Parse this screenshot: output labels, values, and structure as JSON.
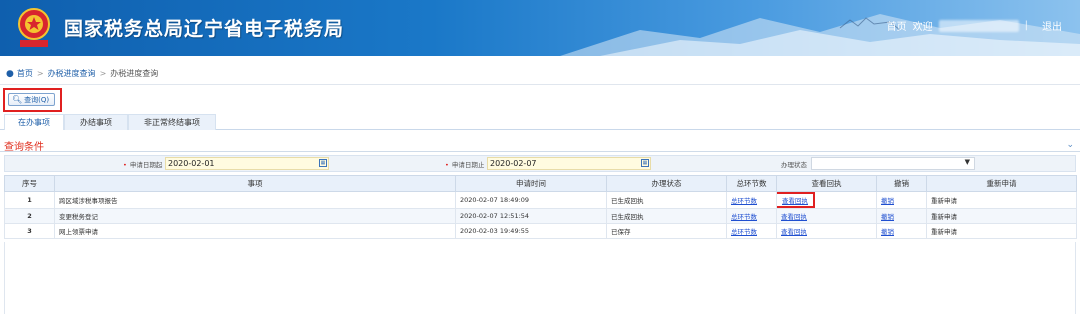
{
  "header": {
    "title": "国家税务总局辽宁省电子税务局",
    "emblem_caption": "中国税务",
    "links": {
      "home": "首页",
      "welcome": "欢迎",
      "logout": "退出",
      "divider": "|"
    }
  },
  "breadcrumb": {
    "items": [
      "首页",
      "办税进度查询",
      "办税进度查询"
    ]
  },
  "toolbar": {
    "query_label": "查询(Q)"
  },
  "tabs": [
    {
      "label": "在办事项",
      "active": true
    },
    {
      "label": "办结事项",
      "active": false
    },
    {
      "label": "非正常终结事项",
      "active": false
    }
  ],
  "conditions": {
    "title": "查询条件",
    "start_date_label": "申请日期起",
    "start_date_value": "2020-02-01",
    "end_date_label": "申请日期止",
    "end_date_value": "2020-02-07",
    "status_label": "办理状态",
    "status_value": ""
  },
  "table": {
    "headers": [
      "序号",
      "事项",
      "申请时间",
      "办理状态",
      "总环节数",
      "查看回执",
      "撤销",
      "重新申请"
    ],
    "rows": [
      {
        "no": "1",
        "item": "跨区域涉税事项报告",
        "time": "2020-02-07 18:49:09",
        "status": "已生成回执",
        "steps": "总环节数",
        "receipt": "查看回执",
        "cancel": "撤销",
        "reapply": "重新申请"
      },
      {
        "no": "2",
        "item": "变更税务登记",
        "time": "2020-02-07 12:51:54",
        "status": "已生成回执",
        "steps": "总环节数",
        "receipt": "查看回执",
        "cancel": "撤销",
        "reapply": "重新申请"
      },
      {
        "no": "3",
        "item": "网上领票申请",
        "time": "2020-02-03 19:49:55",
        "status": "已保存",
        "steps": "总环节数",
        "receipt": "查看回执",
        "cancel": "撤销",
        "reapply": "重新申请"
      }
    ]
  },
  "colors": {
    "header_blue": "#1a78c8",
    "link_blue": "#1f4fd0",
    "highlight_red": "#e02020",
    "date_field_bg": "#fffbe0"
  }
}
